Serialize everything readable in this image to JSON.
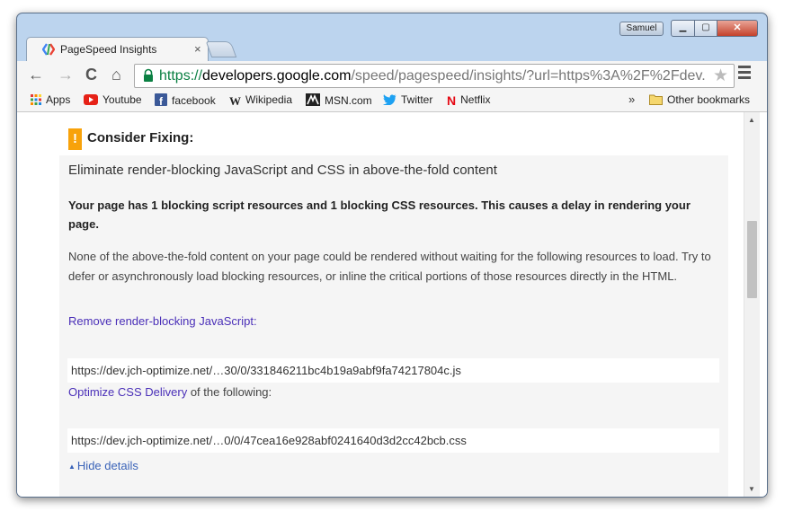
{
  "window": {
    "user": "Samuel",
    "min": "▁",
    "max": "▢",
    "close": "✕"
  },
  "tab": {
    "title": "PageSpeed Insights",
    "favicon": "pagespeed-icon",
    "close": "×"
  },
  "toolbar": {
    "back": "←",
    "forward": "→",
    "reload": "C",
    "home": "⌂",
    "url_scheme": "https://",
    "url_host": "developers.google.com",
    "url_path": "/speed/pagespeed/insights/?url=https%3A%2F%2Fdev.",
    "star": "★"
  },
  "bookmarks": {
    "items": [
      {
        "label": "Apps",
        "icon": "apps-grid-icon"
      },
      {
        "label": "Youtube",
        "icon": "youtube-icon"
      },
      {
        "label": "facebook",
        "icon": "facebook-icon"
      },
      {
        "label": "Wikipedia",
        "icon": "wikipedia-icon"
      },
      {
        "label": "MSN.com",
        "icon": "msn-icon"
      },
      {
        "label": "Twitter",
        "icon": "twitter-icon"
      },
      {
        "label": "Netflix",
        "icon": "netflix-icon"
      }
    ],
    "more": "»",
    "other": "Other bookmarks"
  },
  "content": {
    "warning_symbol": "!",
    "heading": "Consider Fixing:",
    "rule_title": "Eliminate render-blocking JavaScript and CSS in above-the-fold content",
    "summary": "Your page has 1 blocking script resources and 1 blocking CSS resources. This causes a delay in rendering your page.",
    "description": "None of the above-the-fold content on your page could be rendered without waiting for the following resources to load. Try to defer or asynchronously load blocking resources, or inline the critical portions of those resources directly in the HTML.",
    "js_link": "Remove render-blocking JavaScript",
    "js_suffix": ":",
    "js_resource": "https://dev.jch-optimize.net/…30/0/331846211bc4b19a9abf9fa74217804c.js",
    "css_link": "Optimize CSS Delivery",
    "css_suffix": " of the following:",
    "css_resource": "https://dev.jch-optimize.net/…0/0/47cea16e928abf0241640d3d2cc42bcb.css",
    "hide_details": "Hide details"
  },
  "colors": {
    "warning": "#f8a20a",
    "link": "#4a2fb8",
    "url_scheme": "#0b8043"
  }
}
